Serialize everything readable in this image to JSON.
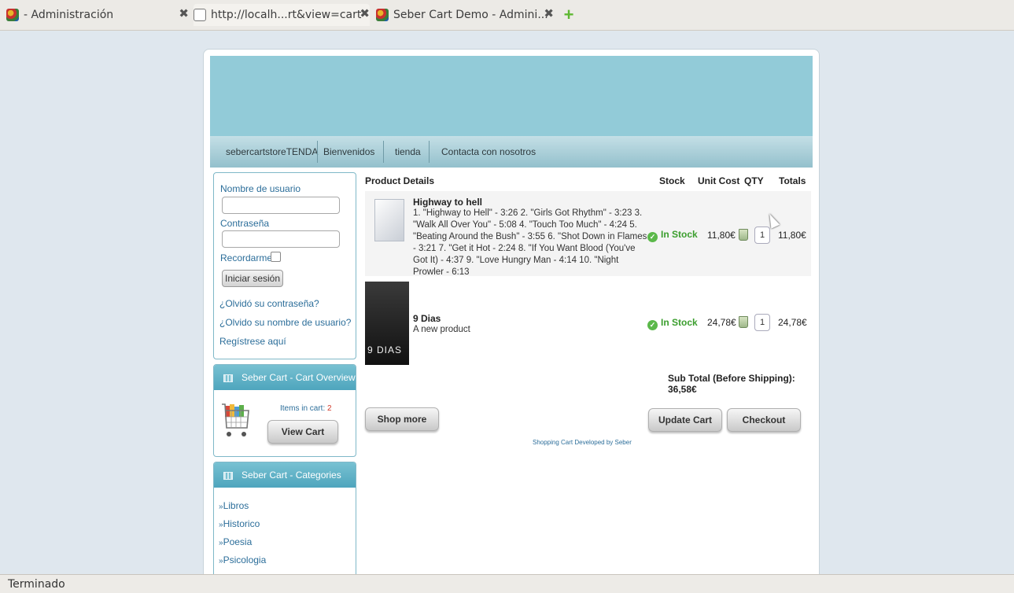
{
  "browser": {
    "tabs": [
      {
        "title": "- Administración"
      },
      {
        "title": "http://localh...rt&view=cart"
      },
      {
        "title": "Seber Cart Demo - Admini..."
      }
    ],
    "new_tab_label": "+",
    "close_glyph": "✖",
    "status_text": "Terminado"
  },
  "nav": {
    "items": [
      "sebercartstoreTENDA",
      "Bienvenidos",
      "tienda",
      "Contacta con nosotros"
    ]
  },
  "login": {
    "username_label": "Nombre de usuario",
    "password_label": "Contraseña",
    "remember_label": "Recordarme",
    "login_button": "Iniciar sesión",
    "forgot_password": "¿Olvidó su contraseña?",
    "forgot_username": "¿Olvido su nombre de usuario?",
    "register": "Regístrese aquí"
  },
  "overview": {
    "title": "Seber Cart - Cart Overview",
    "items_label": "Items in cart:",
    "items_count": "2",
    "view_cart": "View Cart"
  },
  "categories": {
    "title": "Seber Cart - Categories",
    "items": [
      "Libros",
      "Historico",
      "Poesia",
      "Psicologia"
    ]
  },
  "cart": {
    "headers": {
      "details": "Product Details",
      "stock": "Stock",
      "unit_cost": "Unit Cost",
      "qty": "QTY",
      "totals": "Totals"
    },
    "rows": [
      {
        "name": "Highway to hell",
        "description": "1. \"Highway to Hell\" - 3:26 2. \"Girls Got Rhythm\" - 3:23 3. \"Walk All Over You\" - 5:08 4. \"Touch Too Much\" - 4:24 5. \"Beating Around the Bush\" - 3:55 6. \"Shot Down in Flames - 3:21 7. \"Get it Hot - 2:24 8. \"If You Want Blood (You've Got It) - 4:37 9. \"Love Hungry Man - 4:14 10. \"Night Prowler - 6:13",
        "stock": "In Stock",
        "unit_cost": "11,80€",
        "qty": "1",
        "total": "11,80€"
      },
      {
        "name": "9 Dias",
        "description": "A new product",
        "image_text": "9 DIAS",
        "stock": "In Stock",
        "unit_cost": "24,78€",
        "qty": "1",
        "total": "24,78€"
      }
    ],
    "subtotal_label": "Sub Total (Before Shipping):",
    "subtotal_value": "36,58€",
    "shop_more": "Shop more",
    "update_cart": "Update Cart",
    "checkout": "Checkout",
    "credit": "Shopping Cart Developed by Seber"
  }
}
